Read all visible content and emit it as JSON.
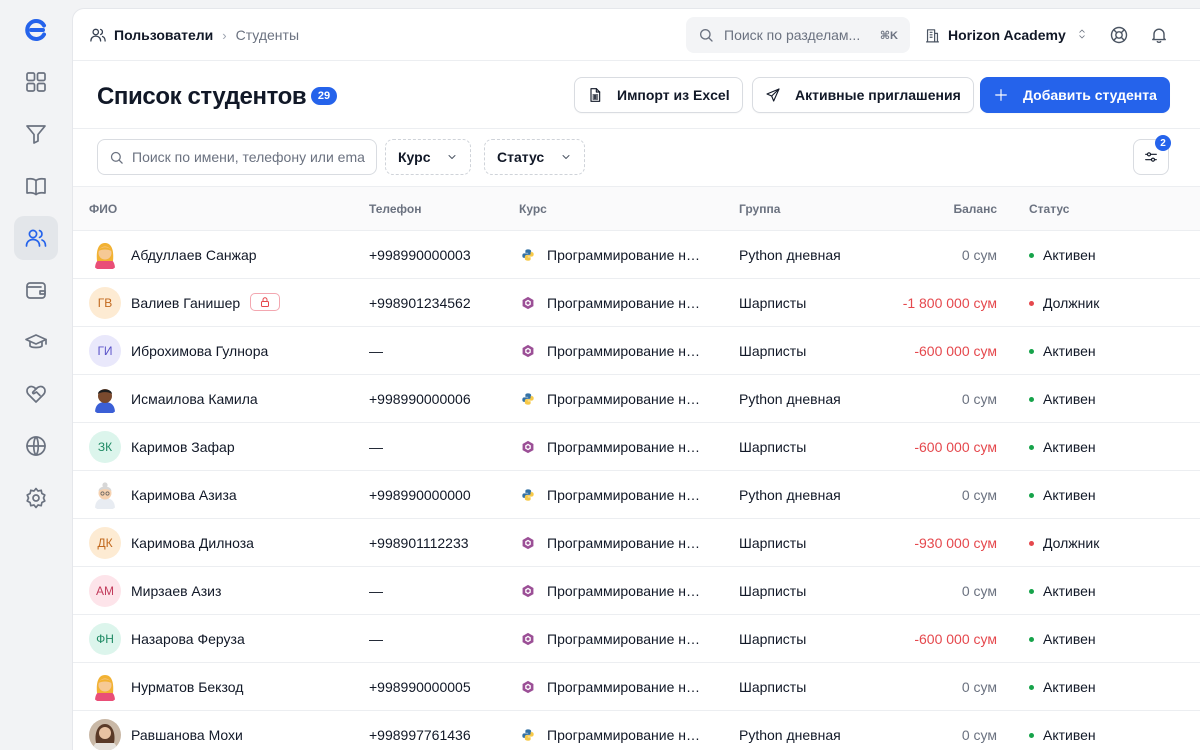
{
  "breadcrumb": {
    "section": "Пользователи",
    "current": "Студенты"
  },
  "global_search": {
    "placeholder": "Поиск по разделам...",
    "shortcut": "⌘K"
  },
  "organization": "Horizon Academy",
  "page": {
    "title": "Список студентов",
    "count": "29",
    "import_label": "Импорт из Excel",
    "invites_label": "Активные приглашения",
    "add_label": "Добавить студента"
  },
  "filters": {
    "search_placeholder": "Поиск по имени, телефону или email",
    "course_label": "Курс",
    "status_label": "Статус",
    "active_count": "2"
  },
  "columns": {
    "name": "ФИО",
    "phone": "Телефон",
    "course": "Курс",
    "group": "Группа",
    "balance": "Баланс",
    "status": "Статус"
  },
  "colors": {
    "accent": "#2563eb",
    "active": "#16a34a",
    "debtor": "#e5484d"
  },
  "students": [
    {
      "name": "Абдуллаев Санжар",
      "avatar": "emoji-female",
      "initials": "",
      "locked": false,
      "phone": "+998990000003",
      "course_icon": "python-icon",
      "course": "Программирование на Python",
      "group": "Python дневная",
      "balance": "0 сум",
      "negative": false,
      "status": "Активен",
      "status_kind": "active"
    },
    {
      "name": "Валиев Ганишер",
      "avatar": "initials",
      "initials": "ГВ",
      "avatar_bg": "#fdebd3",
      "avatar_fg": "#c2691e",
      "locked": true,
      "phone": "+998901234562",
      "course_icon": "csharp-icon",
      "course": "Программирование на C#",
      "group": "Шарписты",
      "balance": "-1 800 000 сум",
      "negative": true,
      "status": "Должник",
      "status_kind": "debtor"
    },
    {
      "name": "Иброхимова Гулнора",
      "avatar": "initials",
      "initials": "ГИ",
      "avatar_bg": "#e9e8fb",
      "avatar_fg": "#5b54c9",
      "locked": false,
      "phone": "—",
      "course_icon": "csharp-icon",
      "course": "Программирование на C#",
      "group": "Шарписты",
      "balance": "-600 000 сум",
      "negative": true,
      "status": "Активен",
      "status_kind": "active"
    },
    {
      "name": "Исмаилова Камила",
      "avatar": "emoji-dark",
      "initials": "",
      "locked": false,
      "phone": "+998990000006",
      "course_icon": "python-icon",
      "course": "Программирование на Python",
      "group": "Python дневная",
      "balance": "0 сум",
      "negative": false,
      "status": "Активен",
      "status_kind": "active"
    },
    {
      "name": "Каримов Зафар",
      "avatar": "initials",
      "initials": "ЗК",
      "avatar_bg": "#dcf5ec",
      "avatar_fg": "#1f8a64",
      "locked": false,
      "phone": "—",
      "course_icon": "csharp-icon",
      "course": "Программирование на C#",
      "group": "Шарписты",
      "balance": "-600 000 сум",
      "negative": true,
      "status": "Активен",
      "status_kind": "active"
    },
    {
      "name": "Каримова Азиза",
      "avatar": "emoji-elder",
      "initials": "",
      "locked": false,
      "phone": "+998990000000",
      "course_icon": "python-icon",
      "course": "Программирование на Python",
      "group": "Python дневная",
      "balance": "0 сум",
      "negative": false,
      "status": "Активен",
      "status_kind": "active"
    },
    {
      "name": "Каримова Дилноза",
      "avatar": "initials",
      "initials": "ДК",
      "avatar_bg": "#fdebd3",
      "avatar_fg": "#c2691e",
      "locked": false,
      "phone": "+998901112233",
      "course_icon": "csharp-icon",
      "course": "Программирование на C#",
      "group": "Шарписты",
      "balance": "-930 000 сум",
      "negative": true,
      "status": "Должник",
      "status_kind": "debtor"
    },
    {
      "name": "Мирзаев Азиз",
      "avatar": "initials",
      "initials": "АМ",
      "avatar_bg": "#fde4ea",
      "avatar_fg": "#c23a5b",
      "locked": false,
      "phone": "—",
      "course_icon": "csharp-icon",
      "course": "Программирование на C#",
      "group": "Шарписты",
      "balance": "0 сум",
      "negative": false,
      "status": "Активен",
      "status_kind": "active"
    },
    {
      "name": "Назарова Феруза",
      "avatar": "initials",
      "initials": "ФН",
      "avatar_bg": "#dcf5ec",
      "avatar_fg": "#1f8a64",
      "locked": false,
      "phone": "—",
      "course_icon": "csharp-icon",
      "course": "Программирование на C#",
      "group": "Шарписты",
      "balance": "-600 000 сум",
      "negative": true,
      "status": "Активен",
      "status_kind": "active"
    },
    {
      "name": "Нурматов Бекзод",
      "avatar": "emoji-female",
      "initials": "",
      "locked": false,
      "phone": "+998990000005",
      "course_icon": "csharp-icon",
      "course": "Программирование на C#",
      "group": "Шарписты",
      "balance": "0 сум",
      "negative": false,
      "status": "Активен",
      "status_kind": "active"
    },
    {
      "name": "Равшанова Мохи",
      "avatar": "photo",
      "initials": "",
      "locked": false,
      "phone": "+998997761436",
      "course_icon": "python-icon",
      "course": "Программирование на Python",
      "group": "Python дневная",
      "balance": "0 сум",
      "negative": false,
      "status": "Активен",
      "status_kind": "active"
    }
  ]
}
